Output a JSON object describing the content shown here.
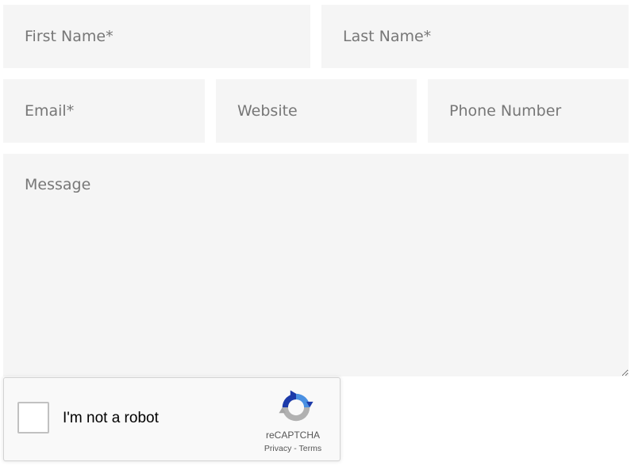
{
  "form": {
    "first_name": {
      "placeholder": "First Name*",
      "value": ""
    },
    "last_name": {
      "placeholder": "Last Name*",
      "value": ""
    },
    "email": {
      "placeholder": "Email*",
      "value": ""
    },
    "website": {
      "placeholder": "Website",
      "value": ""
    },
    "phone": {
      "placeholder": "Phone Number",
      "value": ""
    },
    "message": {
      "placeholder": "Message",
      "value": ""
    }
  },
  "recaptcha": {
    "checkbox_label": "I'm not a robot",
    "brand": "reCAPTCHA",
    "privacy_label": "Privacy",
    "separator": "-",
    "terms_label": "Terms",
    "logo_icon": "recaptcha-logo-icon",
    "colors": {
      "blue_dark": "#1c3aa9",
      "blue_light": "#4a90e2",
      "gray": "#b1b1b1"
    }
  }
}
